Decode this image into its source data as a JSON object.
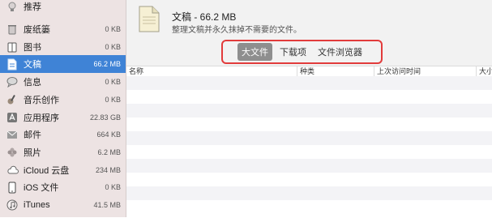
{
  "sidebar": {
    "items": [
      {
        "label": "推荐",
        "size": "",
        "icon": "lightbulb-icon"
      },
      {
        "label": "废纸篓",
        "size": "0 KB",
        "icon": "trash-icon"
      },
      {
        "label": "图书",
        "size": "0 KB",
        "icon": "book-icon"
      },
      {
        "label": "文稿",
        "size": "66.2 MB",
        "icon": "document-icon",
        "selected": true
      },
      {
        "label": "信息",
        "size": "0 KB",
        "icon": "message-icon"
      },
      {
        "label": "音乐创作",
        "size": "0 KB",
        "icon": "guitar-icon"
      },
      {
        "label": "应用程序",
        "size": "22.83 GB",
        "icon": "app-icon"
      },
      {
        "label": "邮件",
        "size": "664 KB",
        "icon": "mail-icon"
      },
      {
        "label": "照片",
        "size": "6.2 MB",
        "icon": "photos-icon"
      },
      {
        "label": "iCloud 云盘",
        "size": "234 MB",
        "icon": "cloud-icon"
      },
      {
        "label": "iOS 文件",
        "size": "0 KB",
        "icon": "phone-icon"
      },
      {
        "label": "iTunes",
        "size": "41.5 MB",
        "icon": "music-icon"
      }
    ]
  },
  "header": {
    "title": "文稿 - 66.2 MB",
    "subtitle": "整理文稿并永久抹掉不需要的文件。"
  },
  "tabs": [
    {
      "label": "大文件",
      "active": true
    },
    {
      "label": "下载项",
      "active": false
    },
    {
      "label": "文件浏览器",
      "active": false
    }
  ],
  "table": {
    "columns": [
      "名称",
      "种类",
      "上次访问时间",
      "大小"
    ]
  }
}
